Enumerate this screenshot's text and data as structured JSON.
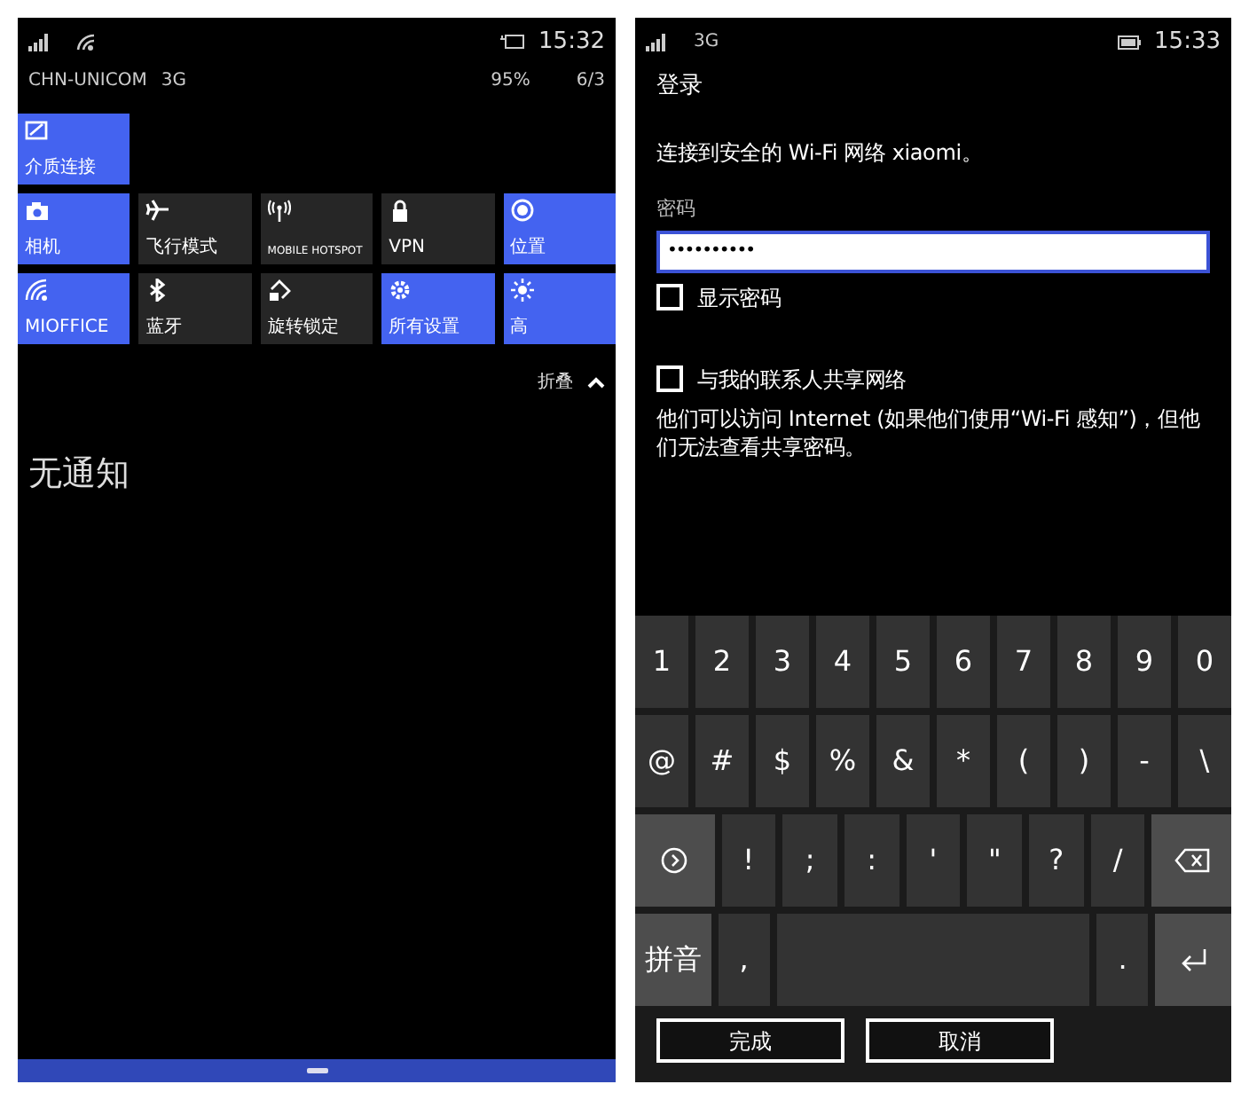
{
  "left_screen": {
    "status_bar": {
      "carrier": "CHN-UNICOM",
      "network": "3G",
      "time": "15:32",
      "battery": "95%",
      "date": "6/3"
    },
    "quick_actions": [
      [
        {
          "label": "介质连接",
          "on": true
        }
      ],
      [
        {
          "label": "相机",
          "on": true
        },
        {
          "label": "飞行模式",
          "on": false
        },
        {
          "label": "MOBILE HOTSPOT",
          "on": false
        },
        {
          "label": "VPN",
          "on": false
        },
        {
          "label": "位置",
          "on": true
        }
      ],
      [
        {
          "label": "MIOFFICE",
          "on": true
        },
        {
          "label": "蓝牙",
          "on": false
        },
        {
          "label": "旋转锁定",
          "on": false
        },
        {
          "label": "所有设置",
          "on": true
        },
        {
          "label": "高",
          "on": true
        }
      ]
    ],
    "collapse": {
      "label": "折叠",
      "expanded": true
    },
    "notifications_message": "无通知"
  },
  "right_screen": {
    "status_bar": {
      "network": "3G",
      "time": "15:33"
    },
    "title": "登录",
    "message": "连接到安全的 Wi-Fi 网络 xiaomi。",
    "password": {
      "label": "密码",
      "value": "••••••••••"
    },
    "show_password": {
      "label": "显示密码",
      "checked": false
    },
    "share_network": {
      "label": "与我的联系人共享网络",
      "checked": false
    },
    "share_note": "他们可以访问 Internet (如果他们使用“Wi-Fi 感知”)，但他们无法查看共享密码。",
    "keyboard": [
      [
        {
          "kind": "char",
          "label": "1"
        },
        {
          "kind": "char",
          "label": "2"
        },
        {
          "kind": "char",
          "label": "3"
        },
        {
          "kind": "char",
          "label": "4"
        },
        {
          "kind": "char",
          "label": "5"
        },
        {
          "kind": "char",
          "label": "6"
        },
        {
          "kind": "char",
          "label": "7"
        },
        {
          "kind": "char",
          "label": "8"
        },
        {
          "kind": "char",
          "label": "9"
        },
        {
          "kind": "char",
          "label": "0"
        }
      ],
      [
        {
          "kind": "char",
          "label": "@"
        },
        {
          "kind": "char",
          "label": "#"
        },
        {
          "kind": "char",
          "label": "$"
        },
        {
          "kind": "char",
          "label": "%"
        },
        {
          "kind": "char",
          "label": "&"
        },
        {
          "kind": "char",
          "label": "*"
        },
        {
          "kind": "char",
          "label": "("
        },
        {
          "kind": "char",
          "label": ")"
        },
        {
          "kind": "char",
          "label": "-"
        },
        {
          "kind": "char",
          "label": "\\"
        }
      ],
      [
        {
          "kind": "more"
        },
        {
          "kind": "char",
          "label": "!"
        },
        {
          "kind": "char",
          "label": ";"
        },
        {
          "kind": "char",
          "label": ":"
        },
        {
          "kind": "char",
          "label": "'"
        },
        {
          "kind": "char",
          "label": "\""
        },
        {
          "kind": "char",
          "label": "?"
        },
        {
          "kind": "char",
          "label": "/"
        },
        {
          "kind": "backspace"
        }
      ],
      [
        {
          "kind": "function",
          "label": "拼音"
        },
        {
          "kind": "char",
          "label": ","
        },
        {
          "kind": "space"
        },
        {
          "kind": "char",
          "label": "."
        },
        {
          "kind": "enter"
        }
      ]
    ],
    "buttons": [
      "完成",
      "取消"
    ]
  }
}
